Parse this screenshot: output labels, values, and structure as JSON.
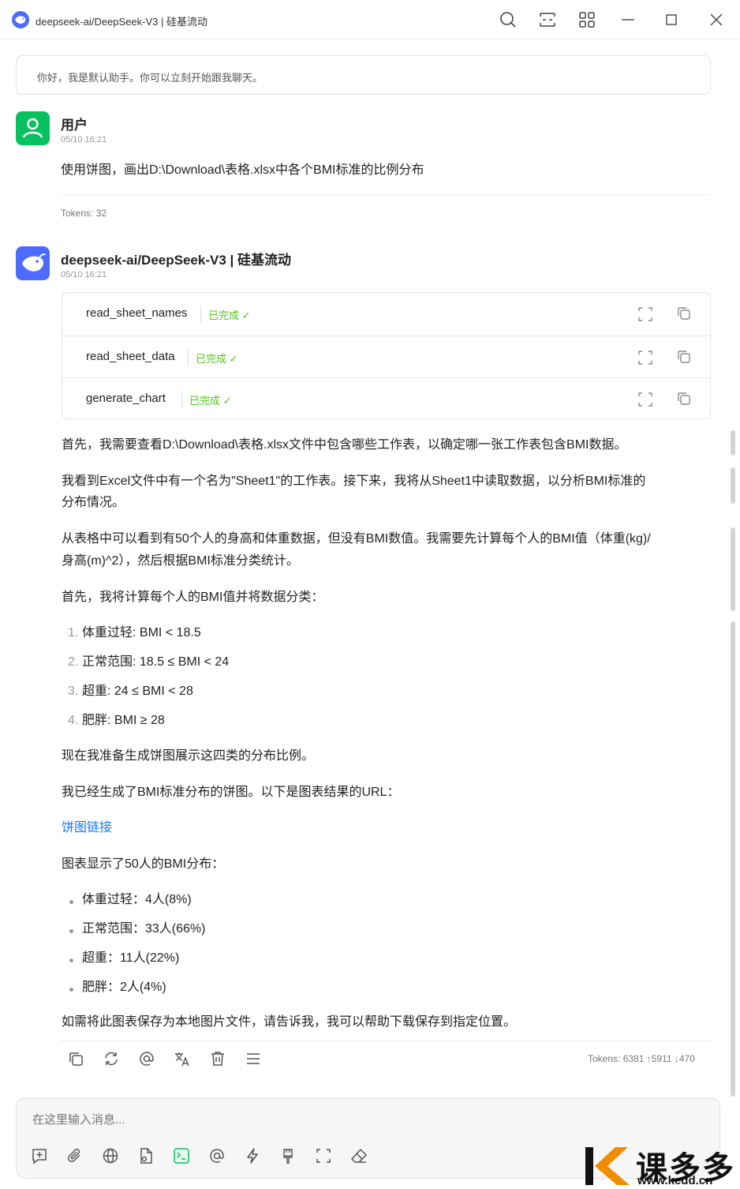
{
  "window": {
    "title": "deepseek-ai/DeepSeek-V3 | 硅基流动"
  },
  "greeting": "你好，我是默认助手。你可以立刻开始跟我聊天。",
  "user_message": {
    "name": "用户",
    "time": "05/10 16:21",
    "text": "使用饼图，画出D:\\Download\\表格.xlsx中各个BMI标准的比例分布",
    "tokens": "Tokens: 32"
  },
  "assistant_message": {
    "name": "deepseek-ai/DeepSeek-V3 | 硅基流动",
    "time": "05/10 16:21",
    "tools": [
      {
        "name": "read_sheet_names",
        "status": "已完成"
      },
      {
        "name": "read_sheet_data",
        "status": "已完成"
      },
      {
        "name": "generate_chart",
        "status": "已完成"
      }
    ],
    "paragraphs": [
      "首先，我需要查看D:\\Download\\表格.xlsx文件中包含哪些工作表，以确定哪一张工作表包含BMI数据。",
      "我看到Excel文件中有一个名为\"Sheet1\"的工作表。接下来，我将从Sheet1中读取数据，以分析BMI标准的",
      "分布情况。",
      "从表格中可以看到有50个人的身高和体重数据，但没有BMI数值。我需要先计算每个人的BMI值（体重(kg)/",
      "身高(m)^2），然后根据BMI标准分类统计。",
      "首先，我将计算每个人的BMI值并将数据分类："
    ],
    "ordered_list": [
      {
        "num": "1.",
        "text": "体重过轻: BMI < 18.5"
      },
      {
        "num": "2.",
        "text": "正常范围: 18.5 ≤ BMI < 24"
      },
      {
        "num": "3.",
        "text": "超重: 24 ≤ BMI < 28"
      },
      {
        "num": "4.",
        "text": "肥胖: BMI ≥ 28"
      }
    ],
    "paragraph_after_list": "现在我准备生成饼图展示这四类的分布比例。",
    "paragraph_url": "我已经生成了BMI标准分布的饼图。以下是图表结果的URL：",
    "link_text": "饼图链接",
    "summary_intro": "图表显示了50人的BMI分布：",
    "bullet_list": [
      "体重过轻：4人(8%)",
      "正常范围：33人(66%)",
      "超重：11人(22%)",
      "肥胖：2人(4%)"
    ],
    "closing": "如需将此图表保存为本地图片文件，请告诉我，我可以帮助下载保存到指定位置。",
    "tokens": "Tokens: 6381 ↑5911 ↓470"
  },
  "input": {
    "placeholder": "在这里输入消息..."
  },
  "watermark": {
    "text": "课多多",
    "url": "www.kedd.cn"
  },
  "colors": {
    "accent": "#4d6bfe",
    "user_avatar": "#07c160",
    "status_done": "#52c41a",
    "link": "#1677ff"
  }
}
